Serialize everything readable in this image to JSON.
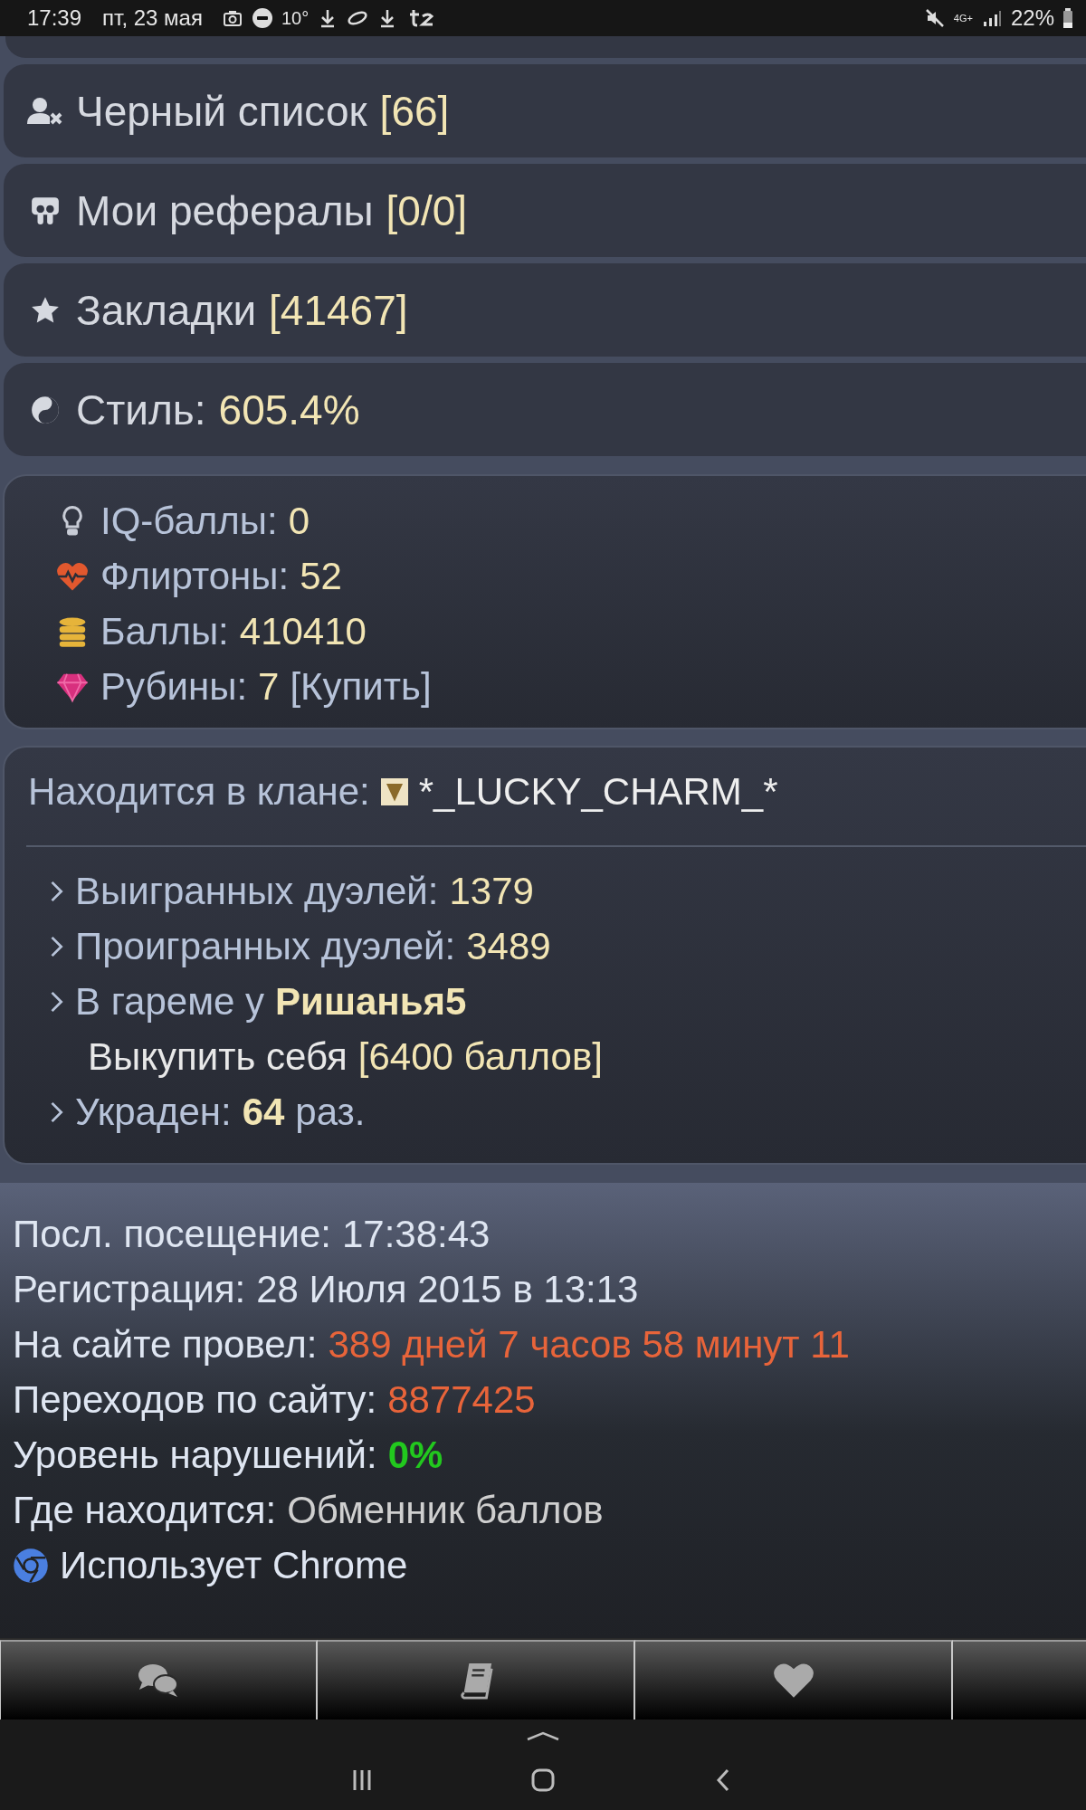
{
  "status_bar": {
    "time": "17:39",
    "date": "пт, 23 мая",
    "temperature": "10°",
    "network": "4G+",
    "battery": "22%"
  },
  "menu": [
    {
      "kind": "blacklist",
      "label": "Черный список",
      "count": "[66]"
    },
    {
      "kind": "referrals",
      "label": "Мои рефералы",
      "count": "[0/0]"
    },
    {
      "kind": "bookmarks",
      "label": "Закладки",
      "count": "[41467]"
    },
    {
      "kind": "style",
      "label": "Стиль:",
      "count": "605.4%"
    }
  ],
  "balances": [
    {
      "kind": "iq",
      "label": "IQ-баллы:",
      "value": "0"
    },
    {
      "kind": "flirt",
      "label": "Флиртоны:",
      "value": "52"
    },
    {
      "kind": "points",
      "label": "Баллы:",
      "value": "410410"
    },
    {
      "kind": "rubies",
      "label": "Рубины:",
      "value": "7",
      "link": "[Купить]"
    }
  ],
  "clan": {
    "label": "Находится в клане:",
    "name": "*_LUCKY_CHARM_*"
  },
  "duel_stats": [
    {
      "kind": "stat",
      "label": "Выигранных дуэлей:",
      "value": "1379",
      "bold": false
    },
    {
      "kind": "stat",
      "label": "Проигранных дуэлей:",
      "value": "3489",
      "bold": false
    },
    {
      "kind": "stat",
      "label": "В гареме у",
      "value": "Ришанья5",
      "bold": true
    },
    {
      "kind": "sub",
      "label": "Выкупить себя",
      "value": "[6400 баллов]",
      "bold": false
    },
    {
      "kind": "stat",
      "label": "Украден:",
      "value": "64",
      "suffix": "раз.",
      "bold": true
    }
  ],
  "info": [
    {
      "kind": "text",
      "label": "Посл. посещение:",
      "value": "17:38:43",
      "color": "#dfe6f2",
      "bold": false
    },
    {
      "kind": "text",
      "label": "Регистрация:",
      "value": "28 Июля 2015 в 13:13",
      "color": "#dfe6f2",
      "bold": false
    },
    {
      "kind": "text",
      "label": "На сайте провел:",
      "value": "389 дней 7 часов 58 минут 11",
      "color": "#e8643a",
      "bold": false
    },
    {
      "kind": "text",
      "label": "Переходов по сайту:",
      "value": "8877425",
      "color": "#e8643a",
      "bold": false
    },
    {
      "kind": "text",
      "label": "Уровень нарушений:",
      "value": "0%",
      "color": "#22c81e",
      "bold": true
    },
    {
      "kind": "text",
      "label": "Где находится:",
      "value": "Обменник баллов",
      "color": "#cfcfcf",
      "bold": false
    },
    {
      "kind": "browser",
      "label": "Использует Chrome"
    }
  ],
  "tab_bar": [
    {
      "kind": "chat"
    },
    {
      "kind": "book"
    },
    {
      "kind": "heart"
    },
    {
      "kind": "blank"
    }
  ]
}
